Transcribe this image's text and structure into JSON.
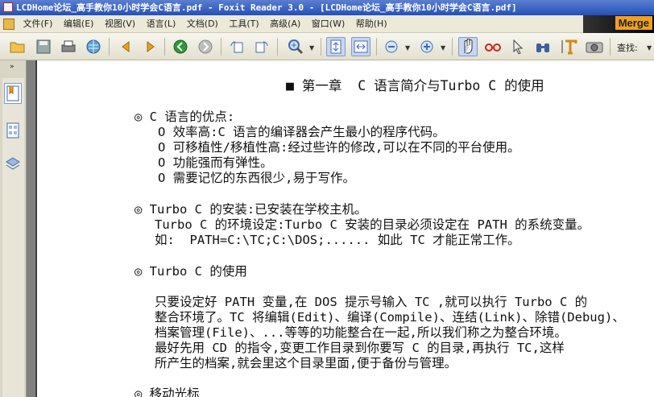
{
  "window": {
    "title": "LCDHome论坛_高手教你10小时学会C语言.pdf - Foxit Reader 3.0 - [LCDHome论坛_高手教你10小时学会C语言.pdf]"
  },
  "menu": [
    "文件(F)",
    "编辑(E)",
    "视图(V)",
    "语言(L)",
    "文档(D)",
    "工具(T)",
    "高级(A)",
    "窗口(W)",
    "帮助(H)"
  ],
  "banner_text": "Merge",
  "find_label": "查找:",
  "sidebar_toggle": "»",
  "icons": {
    "open": "folder-open-icon",
    "save": "save-icon",
    "print": "printer-icon",
    "web": "globe-icon",
    "prev": "arrow-left-icon",
    "next": "arrow-right-icon",
    "back": "back-circle-icon",
    "forward": "forward-circle-icon",
    "zoom": "zoom-in-icon",
    "hand": "hand-icon",
    "typewriter": "typewriter-icon",
    "snapshot": "camera-icon"
  },
  "document": {
    "chapter_heading": "■ 第一章  C 语言简介与Turbo C 的使用",
    "sections": [
      {
        "heading": "◎ C 语言的优点:",
        "lines": [
          "O 效率高:C 语言的编译器会产生最小的程序代码。",
          "O 可移植性/移植性高:经过些许的修改,可以在不同的平台使用。",
          "O 功能强而有弹性。",
          "O 需要记忆的东西很少,易于写作。"
        ]
      },
      {
        "heading": "◎ Turbo C 的安装:已安装在学校主机。",
        "lines": [
          "Turbo C 的环境设定:Turbo C 安装的目录必须设定在 PATH 的系统变量。",
          "如:  PATH=C:\\TC;C:\\DOS;...... 如此 TC 才能正常工作。"
        ]
      },
      {
        "heading": "◎ Turbo C 的使用",
        "lines": [
          "只要设定好 PATH 变量,在 DOS 提示号输入 TC ,就可以执行 Turbo C 的",
          "整合环境了。TC 将编辑(Edit)、编译(Compile)、连结(Link)、除错(Debug)、",
          "档案管理(File)、...等等的功能整合在一起,所以我们称之为整合环境。",
          "最好先用 CD 的指令,变更工作目录到你要写 C 的目录,再执行 TC,这样",
          "所产生的档案,就会里这个目录里面,便于备份与管理。"
        ]
      },
      {
        "heading": "◎ 移动光标",
        "lines": []
      }
    ]
  }
}
